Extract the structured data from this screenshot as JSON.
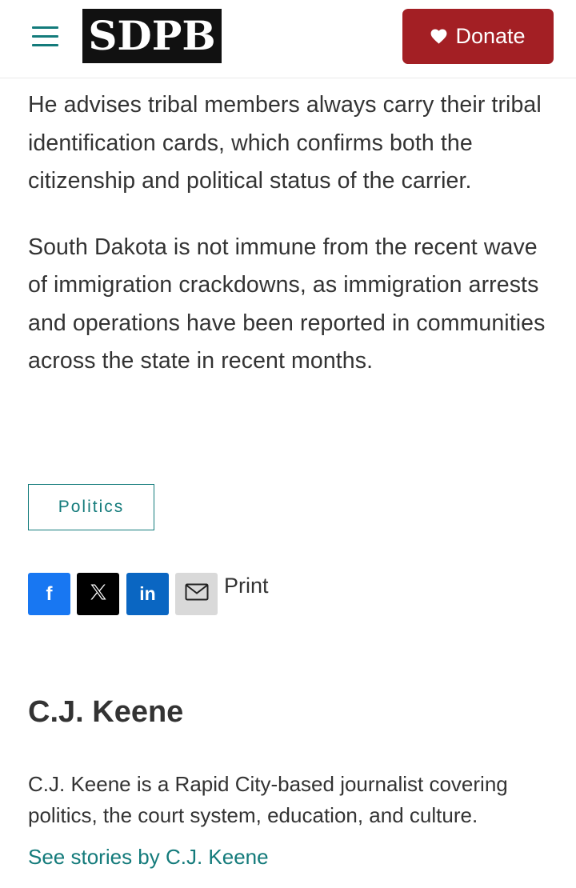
{
  "header": {
    "menu_icon": "hamburger-menu-icon",
    "logo_text": "SDPB",
    "donate_label": "Donate",
    "donate_icon": "heart-icon",
    "colors": {
      "accent": "#147b7b",
      "donate_bg": "#a31f24",
      "logo_bg": "#111111"
    }
  },
  "article": {
    "paragraphs": [
      "He advises tribal members always carry their tribal identification cards, which confirms both the citizenship and political status of the carrier.",
      "South Dakota is not immune from the recent wave of immigration crackdowns, as immigration arrests and operations have been reported in communities across the state in recent months."
    ],
    "tag_label": "Politics"
  },
  "share": {
    "buttons": [
      {
        "name": "facebook",
        "icon": "facebook-icon",
        "color": "#1877f2"
      },
      {
        "name": "x",
        "icon": "x-icon",
        "color": "#000000"
      },
      {
        "name": "linkedin",
        "icon": "linkedin-icon",
        "color": "#0a66c2"
      },
      {
        "name": "email",
        "icon": "email-icon",
        "color": "#d9d9d9"
      }
    ],
    "print_label": "Print"
  },
  "author": {
    "name": "C.J. Keene",
    "bio": "C.J. Keene is a Rapid City-based journalist covering politics, the court system, education, and culture.",
    "link_label": "See stories by C.J. Keene"
  }
}
